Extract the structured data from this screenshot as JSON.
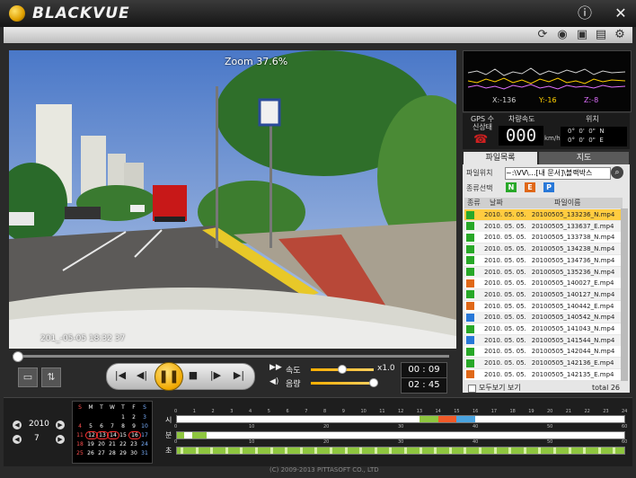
{
  "app": {
    "title": "BLACKVUE"
  },
  "window_buttons": {
    "info": "ⓘ",
    "close": "✕"
  },
  "video": {
    "zoom": "Zoom 37.6%",
    "timestamp": "201_-05-05 18:32 37",
    "progress": 0.01
  },
  "controls": {
    "speed_label": "속도",
    "speed_value": "x1.0",
    "speed_level": 0.48,
    "volume_label": "음량",
    "volume_level": 0.98,
    "current_time": "00 : 09",
    "total_time": "02 : 45"
  },
  "sensor_graph": {
    "labels": [
      "X:-136",
      "Y:-16",
      "Z:-8"
    ],
    "colors": [
      "#d0d0d0",
      "#ffd000",
      "#e070ff"
    ]
  },
  "gps": {
    "label": "GPS 수신상태",
    "speed_label": "차량속도",
    "speed_value": "000",
    "speed_unit": "km/h",
    "pos_label": "위치",
    "lat": "0°  0'  0\"  N",
    "lon": "0°  0'  0\"  E"
  },
  "tabs": [
    {
      "label": "파일목록",
      "active": true
    },
    {
      "label": "지도",
      "active": false
    }
  ],
  "file_panel": {
    "path_label": "파일위치",
    "path_value": "~:\\VV\\...[내 문서]\\블랙박스",
    "type_label": "종류선택",
    "type_buttons": [
      {
        "label": "N",
        "color": "#28a828"
      },
      {
        "label": "E",
        "color": "#e06818"
      },
      {
        "label": "P",
        "color": "#2878d8"
      }
    ],
    "columns": [
      "종류",
      "날짜",
      "파일이름"
    ],
    "files": [
      {
        "type": "N",
        "date": "2010. 05. 05.",
        "name": "20100505_133236_N.mp4",
        "selected": true
      },
      {
        "type": "N",
        "date": "2010. 05. 05.",
        "name": "20100505_133637_E.mp4",
        "selected": false
      },
      {
        "type": "N",
        "date": "2010. 05. 05.",
        "name": "20100505_133738_N.mp4",
        "selected": false
      },
      {
        "type": "N",
        "date": "2010. 05. 05.",
        "name": "20100505_134238_N.mp4",
        "selected": false
      },
      {
        "type": "N",
        "date": "2010. 05. 05.",
        "name": "20100505_134736_N.mp4",
        "selected": false
      },
      {
        "type": "N",
        "date": "2010. 05. 05.",
        "name": "20100505_135236_N.mp4",
        "selected": false
      },
      {
        "type": "E",
        "date": "2010. 05. 05.",
        "name": "20100505_140027_E.mp4",
        "selected": false
      },
      {
        "type": "N",
        "date": "2010. 05. 05.",
        "name": "20100505_140127_N.mp4",
        "selected": false
      },
      {
        "type": "E",
        "date": "2010. 05. 05.",
        "name": "20100505_140442_E.mp4",
        "selected": false
      },
      {
        "type": "P",
        "date": "2010. 05. 05.",
        "name": "20100505_140542_N.mp4",
        "selected": false
      },
      {
        "type": "N",
        "date": "2010. 05. 05.",
        "name": "20100505_141043_N.mp4",
        "selected": false
      },
      {
        "type": "P",
        "date": "2010. 05. 05.",
        "name": "20100505_141544_N.mp4",
        "selected": false
      },
      {
        "type": "N",
        "date": "2010. 05. 05.",
        "name": "20100505_142044_N.mp4",
        "selected": false
      },
      {
        "type": "N",
        "date": "2010. 05. 05.",
        "name": "20100505_142136_E.mp4",
        "selected": false
      },
      {
        "type": "E",
        "date": "2010. 05. 05.",
        "name": "20100505_142135_E.mp4",
        "selected": false
      }
    ],
    "footer_checkbox": "모두보기 보기",
    "total": "total 26"
  },
  "date_nav": {
    "year": "2010",
    "month": "7"
  },
  "calendar": {
    "headers": [
      "S",
      "M",
      "T",
      "W",
      "T",
      "F",
      "S"
    ],
    "days": [
      "",
      "",
      "",
      "",
      "1",
      "2",
      "3",
      "4",
      "5",
      "6",
      "7",
      "8",
      "9",
      "10",
      "11",
      "12",
      "13",
      "14",
      "15",
      "16",
      "17",
      "18",
      "19",
      "20",
      "21",
      "22",
      "23",
      "24",
      "25",
      "26",
      "27",
      "28",
      "29",
      "30",
      "31"
    ],
    "marked": [
      "12",
      "13",
      "14",
      "16"
    ]
  },
  "timeline": {
    "row_labels": [
      "시",
      "분",
      "초"
    ],
    "hour_ticks": [
      "0",
      "1",
      "2",
      "3",
      "4",
      "5",
      "6",
      "7",
      "8",
      "9",
      "10",
      "11",
      "12",
      "13",
      "14",
      "15",
      "16",
      "17",
      "18",
      "19",
      "20",
      "21",
      "22",
      "23",
      "24"
    ],
    "minute_ticks": [
      "0",
      "10",
      "20",
      "30",
      "40",
      "50",
      "60"
    ],
    "second_ticks": [
      "0",
      "10",
      "20",
      "30",
      "40",
      "50",
      "60"
    ],
    "hour_segments": [
      {
        "start": 13,
        "end": 14,
        "color": "#8ec63f"
      },
      {
        "start": 14,
        "end": 15,
        "color": "#f05a28"
      },
      {
        "start": 15,
        "end": 16,
        "color": "#4aa3df"
      }
    ],
    "minute_segments": [
      {
        "start": 0,
        "end": 1,
        "color": "#8ec63f"
      },
      {
        "start": 2,
        "end": 4,
        "color": "#8ec63f"
      }
    ]
  },
  "footer": {
    "copyright": "(C) 2009-2013 PITTASOFT CO., LTD"
  }
}
